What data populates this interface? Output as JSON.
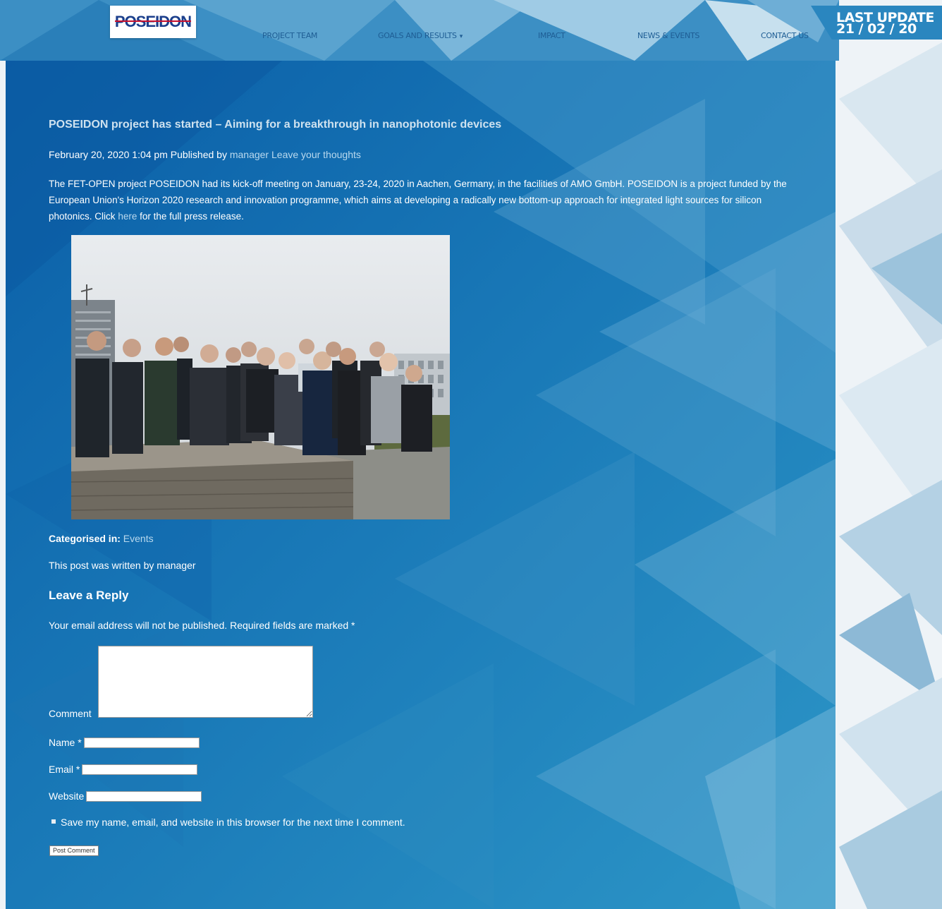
{
  "header": {
    "logo_text": "POSEIDON",
    "nav": [
      {
        "label": "PROJECT TEAM",
        "caret": ""
      },
      {
        "label": "GOALS AND RESULTS",
        "caret": "▾"
      },
      {
        "label": "IMPACT",
        "caret": ""
      },
      {
        "label": "NEWS & EVENTS",
        "caret": ""
      },
      {
        "label": "CONTACT US",
        "caret": ""
      }
    ],
    "last_update_label": "LAST UPDATE",
    "last_update_date": "21 / 02 / 20"
  },
  "post": {
    "title": "POSEIDON project has started – Aiming for a breakthrough in nanophotonic devices",
    "date": "February 20, 2020 1:04 pm",
    "published_by": "Published by",
    "author": "manager",
    "leave_thoughts": "Leave your thoughts",
    "body_before_link": "The FET-OPEN project POSEIDON had its kick-off meeting on January, 23-24, 2020 in Aachen, Germany, in the facilities of AMO GmbH. POSEIDON is a project funded by the European Union's Horizon 2020 research and innovation programme, which aims at developing a radically new bottom-up approach for integrated light sources for silicon photonics. Click",
    "body_link": "here",
    "body_after_link": "for the full press release.",
    "categorised_label": "Categorised in:",
    "category": "Events",
    "written_by": "This post was written by manager"
  },
  "reply": {
    "title": "Leave a Reply",
    "notice": "Your email address will not be published. Required fields are marked *",
    "comment_label": "Comment",
    "name_label": "Name *",
    "email_label": "Email *",
    "website_label": "Website",
    "cookie_label": "Save my name, email, and website in this browser for the next time I comment.",
    "submit_label": "Post Comment"
  }
}
